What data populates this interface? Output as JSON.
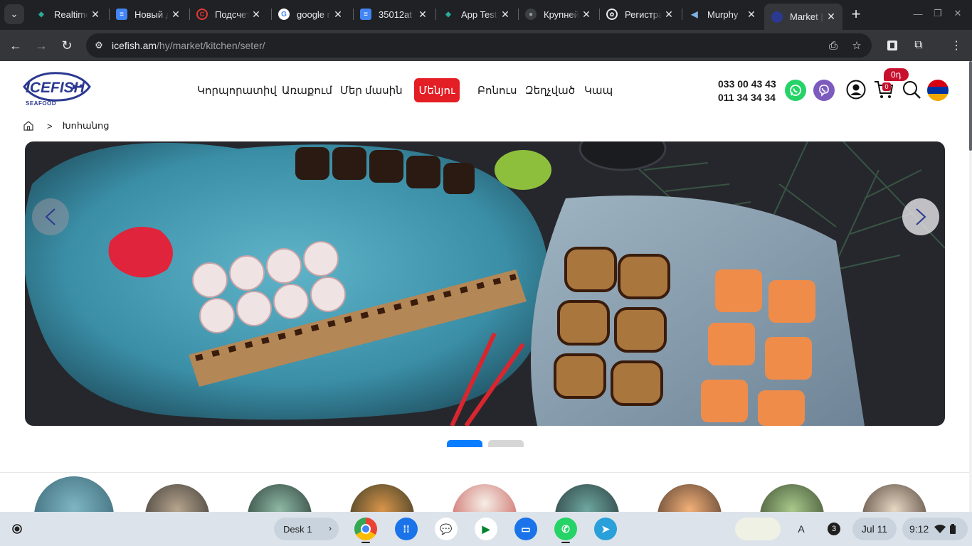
{
  "browser": {
    "tabs": [
      {
        "title": "Realtime",
        "favicon": "pinwheel-icon",
        "color": "#2bb3a3"
      },
      {
        "title": "Новый документ",
        "favicon": "docs-icon",
        "color": "#4285f4"
      },
      {
        "title": "Подсчет",
        "favicon": "copyright-icon",
        "color": "#e53935"
      },
      {
        "title": "google переводчик",
        "favicon": "google-icon",
        "color": "#ffffff"
      },
      {
        "title": "35012at",
        "favicon": "docs-icon",
        "color": "#4285f4"
      },
      {
        "title": "App Test",
        "favicon": "pinwheel-icon",
        "color": "#2bb3a3"
      },
      {
        "title": "Крупнейший",
        "favicon": "github-icon",
        "color": "#5f6368"
      },
      {
        "title": "Регистрация",
        "favicon": "openai-icon",
        "color": "#e8eaed"
      },
      {
        "title": "Murphy",
        "favicon": "fish-icon",
        "color": "#7fb2e5"
      },
      {
        "title": "Market | Icefish",
        "favicon": "icefish-icon",
        "color": "#2b3990"
      }
    ],
    "url_host": "icefish.am",
    "url_path": "/hy/market/kitchen/seter/"
  },
  "site": {
    "logo_text": "ICEFISH",
    "logo_sub": "SEAFOOD",
    "nav": [
      {
        "label": "Կորպորատիվ"
      },
      {
        "label": "Առաքում"
      },
      {
        "label": "Մեր մասին"
      },
      {
        "label": "Մենյու"
      },
      {
        "label": "Բոնուս"
      },
      {
        "label": "Զեղչված"
      },
      {
        "label": "Կապ"
      }
    ],
    "phone_1": "033 00 43 43",
    "phone_2": "011 34 34 34",
    "cart_total": "0դ",
    "cart_count": "0",
    "accent": "#e31e24"
  },
  "breadcrumb": {
    "separator": ">",
    "current": "Խոհանոց"
  },
  "carousel": {
    "active_index": 0,
    "count": 2,
    "active_color": "#0a7cff",
    "inactive_color": "#d6d6d6"
  },
  "shelf": {
    "desk_label": "Desk 1",
    "notification_count": "3",
    "ime_label": "A",
    "date": "Jul 11",
    "time": "9:12"
  }
}
